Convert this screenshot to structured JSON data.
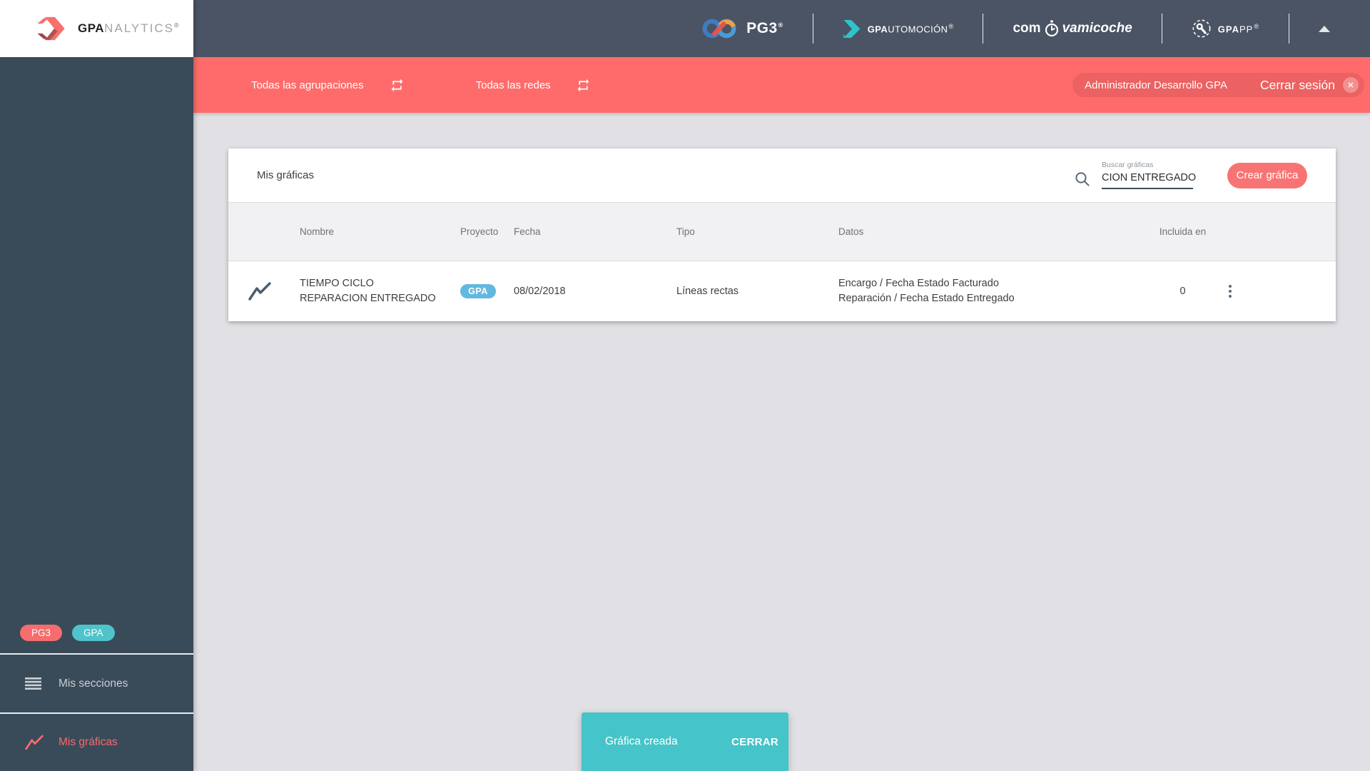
{
  "brand": {
    "logo_bold": "GPA",
    "logo_light": "NALYTICS",
    "registered": "®"
  },
  "topbar": {
    "pg3": "PG3",
    "gpautomocion_bold": "GPA",
    "gpautomocion_rest": "UTOMOCIÓN",
    "comova_prefix": "com",
    "comova_suffix": "vamicoche",
    "gpapp_bold": "GPA",
    "gpapp_rest": "PP"
  },
  "filters": {
    "groupings": "Todas las agrupaciones",
    "networks": "Todas las redes",
    "user": "Administrador Desarrollo GPA",
    "logout": "Cerrar sesión",
    "logout_close": "✕"
  },
  "sidebar": {
    "badges": [
      {
        "label": "PG3",
        "color": "#f76c6c"
      },
      {
        "label": "GPA",
        "color": "#4ec3c9"
      }
    ],
    "items": [
      {
        "label": "Mis secciones",
        "icon": "menu-icon",
        "active": false
      },
      {
        "label": "Mis gráficas",
        "icon": "chart-line-icon",
        "active": true
      }
    ]
  },
  "main": {
    "title": "Mis gráficas",
    "search_label": "Buscar gráficas",
    "search_value": "CION ENTREGADO",
    "create_button": "Crear gráfica"
  },
  "table": {
    "headers": {
      "name": "Nombre",
      "project": "Proyecto",
      "date": "Fecha",
      "type": "Tipo",
      "data": "Datos",
      "included": "Incluida en"
    },
    "rows": [
      {
        "name": "TIEMPO CICLO REPARACION ENTREGADO",
        "project_badge": "GPA",
        "date": "08/02/2018",
        "type": "Líneas rectas",
        "data_line1": "Encargo / Fecha Estado Facturado",
        "data_line2": "Reparación / Fecha Estado Entregado",
        "included": "0"
      }
    ]
  },
  "toast": {
    "message": "Gráfica creada",
    "action": "CERRAR"
  },
  "colors": {
    "accent": "#ff6b6b",
    "topbar_bg": "#4a5464",
    "sidebar_bg": "#394a59",
    "toast_teal": "#45c4c9",
    "badge_teal": "#4ec3c9",
    "project_badge_blue": "#62b8df",
    "content_bg": "#e1e1e5"
  }
}
